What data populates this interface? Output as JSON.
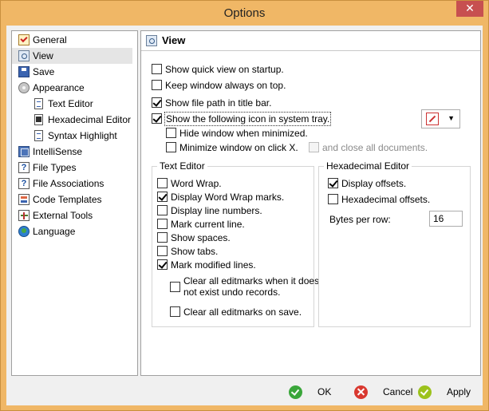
{
  "window": {
    "title": "Options",
    "close_glyph": "✕"
  },
  "nav": {
    "items": [
      {
        "label": "General",
        "icon": "checklist-icon"
      },
      {
        "label": "View",
        "icon": "view-icon"
      },
      {
        "label": "Save",
        "icon": "save-icon"
      },
      {
        "label": "Appearance",
        "icon": "appearance-icon"
      },
      {
        "label": "Text Editor",
        "icon": "document-icon"
      },
      {
        "label": "Hexadecimal Editor",
        "icon": "hex-document-icon"
      },
      {
        "label": "Syntax Highlight",
        "icon": "document-icon"
      },
      {
        "label": "IntelliSense",
        "icon": "intellisense-icon"
      },
      {
        "label": "File Types",
        "icon": "help-icon"
      },
      {
        "label": "File Associations",
        "icon": "help-icon"
      },
      {
        "label": "Code Templates",
        "icon": "template-icon"
      },
      {
        "label": "External Tools",
        "icon": "tools-icon"
      },
      {
        "label": "Language",
        "icon": "globe-icon"
      }
    ],
    "selected": "View"
  },
  "panel": {
    "title": "View",
    "options": {
      "quick_view": {
        "label": "Show quick view on startup.",
        "checked": false
      },
      "always_on_top": {
        "label": "Keep window always on top.",
        "checked": false
      },
      "file_path_title": {
        "label": "Show file path in title bar.",
        "checked": true
      },
      "system_tray": {
        "label": "Show the following icon in system tray.",
        "checked": true
      },
      "hide_minimized": {
        "label": "Hide window when minimized.",
        "checked": false
      },
      "minimize_close": {
        "label": "Minimize window on click X.",
        "checked": false
      },
      "close_all_docs": {
        "label": "and close all documents.",
        "checked": false,
        "enabled": false
      }
    },
    "tray_icon_select": {
      "selected": "pencil-icon"
    },
    "text_editor": {
      "title": "Text Editor",
      "items": [
        {
          "label": "Word Wrap.",
          "checked": false
        },
        {
          "label": "Display Word Wrap marks.",
          "checked": true
        },
        {
          "label": "Display line numbers.",
          "checked": false
        },
        {
          "label": "Mark current line.",
          "checked": false
        },
        {
          "label": "Show spaces.",
          "checked": false
        },
        {
          "label": "Show tabs.",
          "checked": false
        },
        {
          "label": "Mark modified lines.",
          "checked": true
        }
      ],
      "clear_undo": {
        "line1": "Clear all editmarks when it does",
        "line2": "not exist undo records.",
        "checked": false
      },
      "clear_save": {
        "label": "Clear all editmarks on save.",
        "checked": false
      }
    },
    "hex_editor": {
      "title": "Hexadecimal Editor",
      "display_offsets": {
        "label": "Display offsets.",
        "checked": true
      },
      "hex_offsets": {
        "label": "Hexadecimal offsets.",
        "checked": false
      },
      "bytes_per_row": {
        "label": "Bytes per row:",
        "value": "16"
      }
    }
  },
  "footer": {
    "ok": "OK",
    "cancel": "Cancel",
    "apply": "Apply"
  },
  "colors": {
    "frame": "#f0b766",
    "ok_icon": "#3aa63a",
    "cancel_icon": "#d9382f",
    "apply_icon": "#9cc21c"
  }
}
